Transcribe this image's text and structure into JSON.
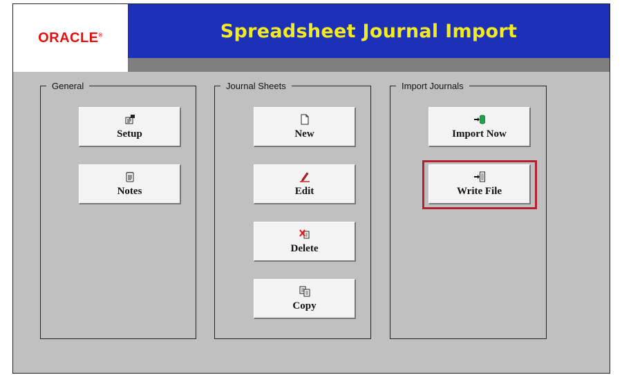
{
  "header": {
    "logo_text": "ORACLE",
    "logo_mark": "®",
    "title": "Spreadsheet Journal Import"
  },
  "groups": {
    "general": {
      "legend": "General",
      "buttons": {
        "setup": {
          "label": "Setup",
          "icon": "setup-icon"
        },
        "notes": {
          "label": "Notes",
          "icon": "notes-icon"
        }
      }
    },
    "journal_sheets": {
      "legend": "Journal Sheets",
      "buttons": {
        "new": {
          "label": "New",
          "icon": "new-document-icon"
        },
        "edit": {
          "label": "Edit",
          "icon": "edit-pencil-icon"
        },
        "delete": {
          "label": "Delete",
          "icon": "delete-icon"
        },
        "copy": {
          "label": "Copy",
          "icon": "copy-icon"
        }
      }
    },
    "import_journals": {
      "legend": "Import Journals",
      "buttons": {
        "import_now": {
          "label": "Import Now",
          "icon": "import-database-icon"
        },
        "write_file": {
          "label": "Write File",
          "icon": "write-file-icon",
          "highlighted": true
        }
      }
    }
  },
  "colors": {
    "title_bar": "#1d30b8",
    "title_text": "#f4ea22",
    "logo": "#e3100f",
    "panel_background": "#c0c0c0",
    "highlight_border": "#b3202f"
  }
}
